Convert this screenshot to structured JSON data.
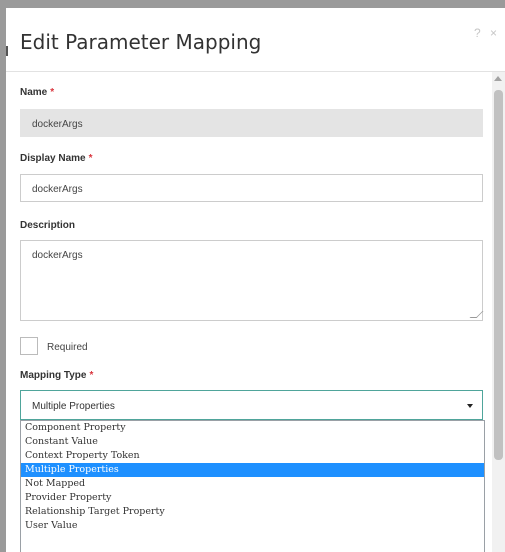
{
  "dialog": {
    "title": "Edit Parameter Mapping",
    "help_icon": "help-icon",
    "close_icon": "close-icon",
    "help_glyph": "?",
    "close_glyph": "×"
  },
  "form": {
    "name": {
      "label": "Name",
      "required_mark": "*",
      "value": "dockerArgs"
    },
    "display_name": {
      "label": "Display Name",
      "required_mark": "*",
      "value": "dockerArgs"
    },
    "description": {
      "label": "Description",
      "value": "dockerArgs"
    },
    "required_checkbox": {
      "label": "Required",
      "checked": false
    },
    "mapping_type": {
      "label": "Mapping Type",
      "required_mark": "*",
      "selected": "Multiple Properties",
      "options": [
        "Component Property",
        "Constant Value",
        "Context Property Token",
        "Multiple Properties",
        "Not Mapped",
        "Provider Property",
        "Relationship Target Property",
        "User Value"
      ]
    }
  },
  "colors": {
    "required": "#d9363e",
    "select_focus_border": "#4fa59b",
    "option_selected": "#1e90ff"
  }
}
